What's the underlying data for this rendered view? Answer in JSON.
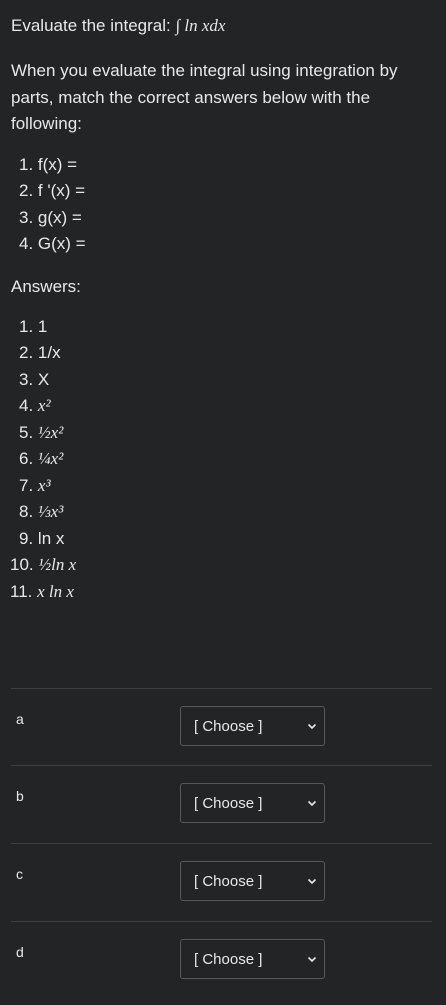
{
  "question": {
    "title_prefix": "Evaluate the integral: ",
    "integral_expr": "∫ ln xdx",
    "intro": "When you evaluate the integral using integration by parts, match the correct answers below with the following:",
    "items": [
      "1. f(x) =",
      "2. f '(x) =",
      "3. g(x) =",
      "4. G(x) ="
    ],
    "answers_title": "Answers:",
    "answers": [
      {
        "num": "1.",
        "text": "1"
      },
      {
        "num": "2.",
        "text": "1/x"
      },
      {
        "num": "3.",
        "text": "X"
      },
      {
        "num": "4.",
        "text": "x²"
      },
      {
        "num": "5.",
        "text": "½x²"
      },
      {
        "num": "6.",
        "text": "¼x²"
      },
      {
        "num": "7.",
        "text": "x³"
      },
      {
        "num": "8.",
        "text": "⅓x³"
      },
      {
        "num": "9.",
        "text": "ln x"
      },
      {
        "num": "10.",
        "text": "½ln x"
      },
      {
        "num": "11.",
        "text": "x ln x"
      }
    ]
  },
  "matching": {
    "rows": [
      {
        "label": "a",
        "selected": "[ Choose ]"
      },
      {
        "label": "b",
        "selected": "[ Choose ]"
      },
      {
        "label": "c",
        "selected": "[ Choose ]"
      },
      {
        "label": "d",
        "selected": "[ Choose ]"
      }
    ],
    "chevron_icon": "chevron-down-icon"
  }
}
